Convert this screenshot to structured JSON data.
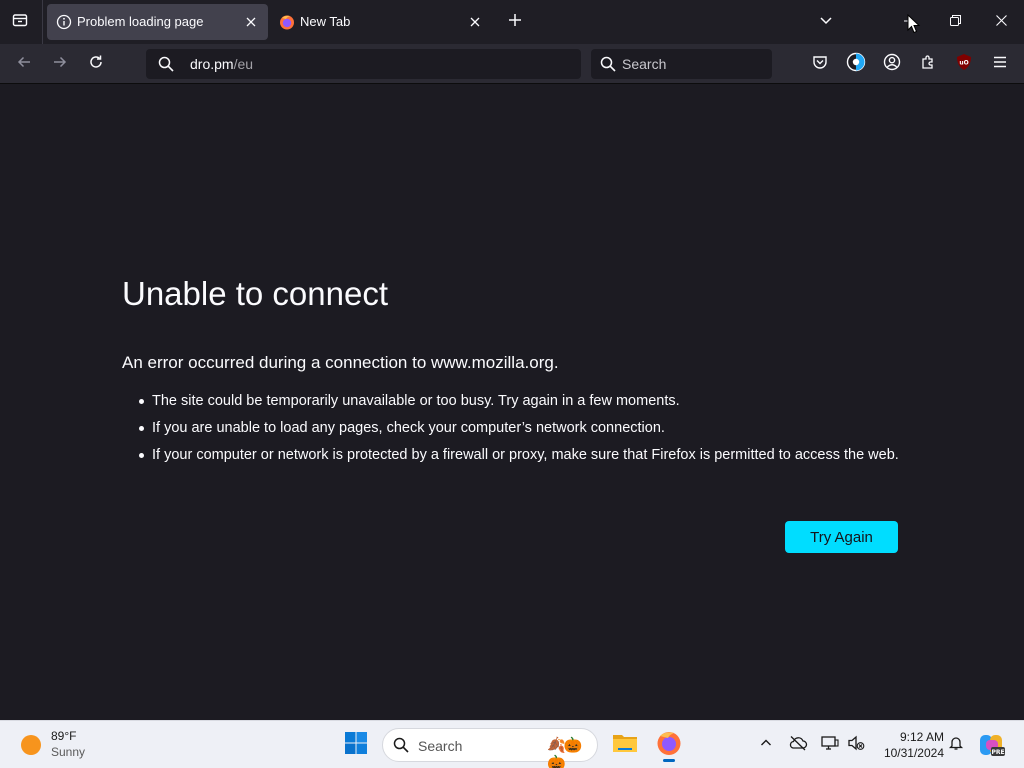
{
  "browser": {
    "tabs": [
      {
        "title": "Problem loading page",
        "active": true,
        "icon": "info-icon"
      },
      {
        "title": "New Tab",
        "active": false,
        "icon": "firefox-icon"
      }
    ],
    "url": {
      "host": "dro.pm",
      "path": "/eu"
    },
    "search_placeholder": "Search"
  },
  "error_page": {
    "title": "Unable to connect",
    "intro": "An error occurred during a connection to www.mozilla.org.",
    "bullets": [
      "The site could be temporarily unavailable or too busy. Try again in a few moments.",
      "If you are unable to load any pages, check your computer’s network connection.",
      "If your computer or network is protected by a firewall or proxy, make sure that Firefox is permitted to access the web."
    ],
    "button_label": "Try Again"
  },
  "taskbar": {
    "weather": {
      "temp": "89°F",
      "condition": "Sunny"
    },
    "search_placeholder": "Search",
    "clock": {
      "time": "9:12 AM",
      "date": "10/31/2024"
    }
  },
  "colors": {
    "page_bg": "#1c1b22",
    "toolbar_bg": "#2b2a33",
    "accent": "#00ddff",
    "taskbar_bg": "#eef0f6"
  }
}
